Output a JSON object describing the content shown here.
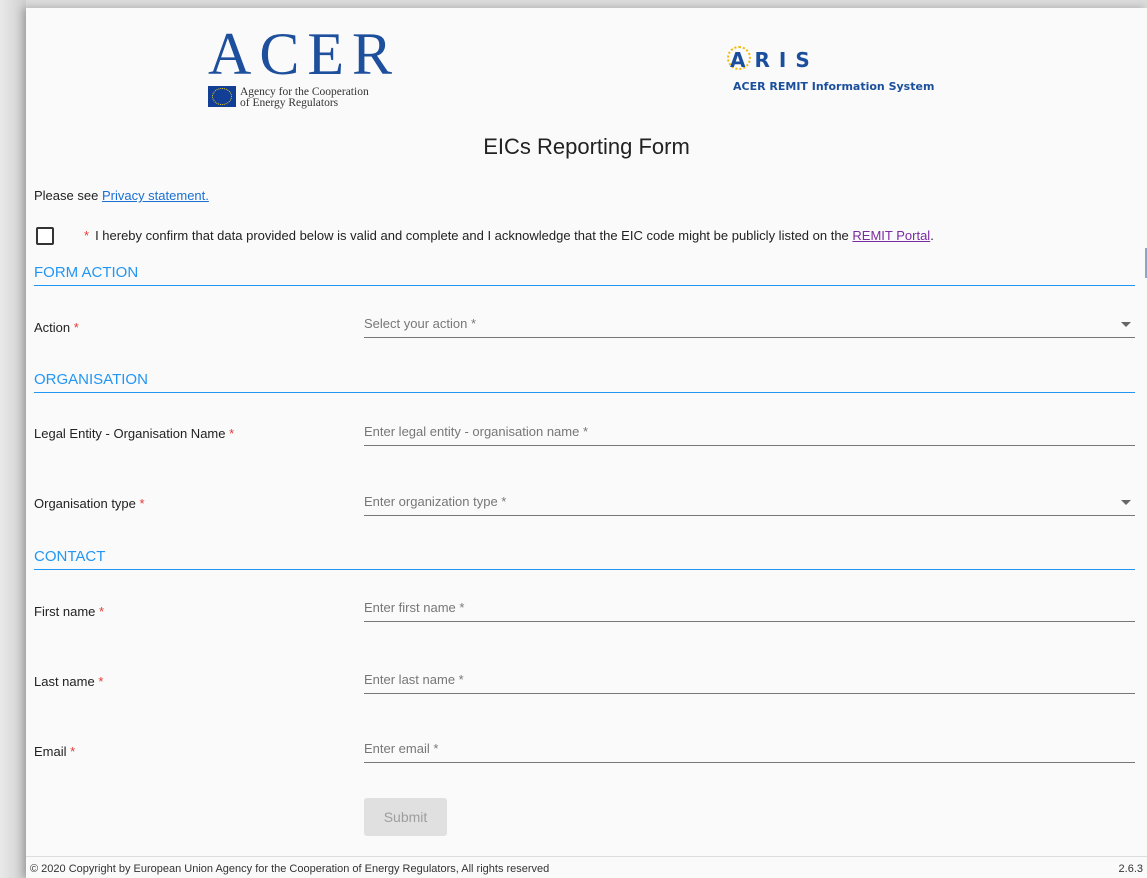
{
  "logos": {
    "acer": {
      "word": "ACER",
      "subtitle_line1": "Agency for the Cooperation",
      "subtitle_line2": "of Energy Regulators"
    },
    "aris": {
      "word": "ARIS",
      "subtitle": "ACER REMIT Information System"
    }
  },
  "page_title": "EICs Reporting Form",
  "privacy": {
    "prefix": "Please see",
    "link": "Privacy statement."
  },
  "confirm": {
    "required_mark": "*",
    "text": "I hereby confirm that data provided below is valid and complete and I acknowledge that the EIC code might be publicly listed on the",
    "link": "REMIT Portal",
    "suffix": "."
  },
  "sections": {
    "form_action": "FORM ACTION",
    "organisation": "ORGANISATION",
    "contact": "CONTACT"
  },
  "fields": {
    "action": {
      "label": "Action",
      "placeholder": "Select your action *"
    },
    "legal_entity": {
      "label": "Legal Entity - Organisation Name",
      "placeholder": "Enter legal entity - organisation name *"
    },
    "org_type": {
      "label": "Organisation type",
      "placeholder": "Enter organization type *"
    },
    "first_name": {
      "label": "First name",
      "placeholder": "Enter first name *"
    },
    "last_name": {
      "label": "Last name",
      "placeholder": "Enter last name *"
    },
    "email": {
      "label": "Email",
      "placeholder": "Enter email *"
    }
  },
  "required_mark": "*",
  "submit_label": "Submit",
  "footer": {
    "copyright": "© 2020 Copyright by European Union Agency for the Cooperation of Energy Regulators, All rights reserved",
    "version": "2.6.3"
  },
  "colors": {
    "accent": "#2196f3",
    "required": "#e53935",
    "brand": "#1d4f9c"
  }
}
